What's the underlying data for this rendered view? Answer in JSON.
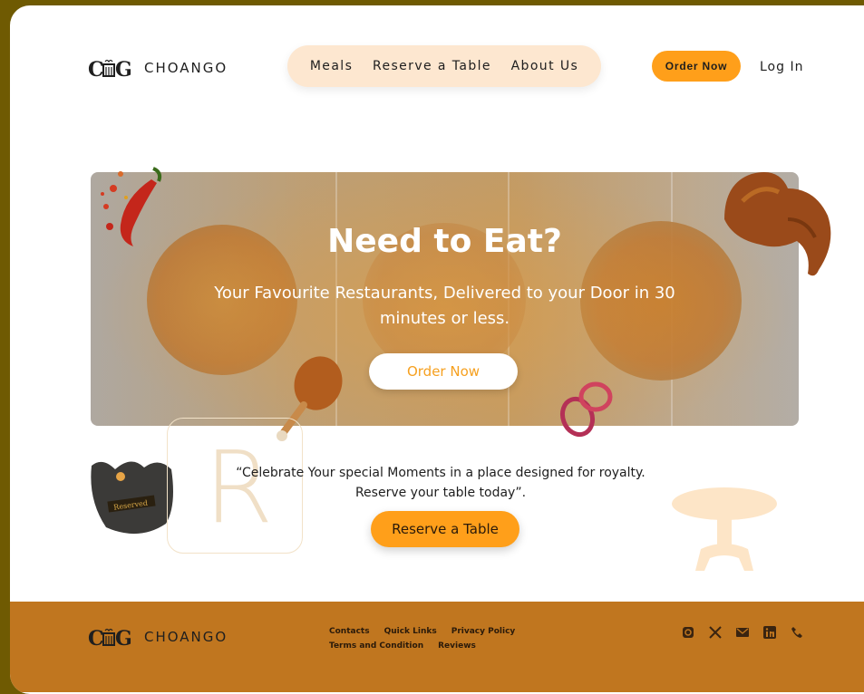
{
  "brand": {
    "name": "CHOANGO"
  },
  "header": {
    "nav": [
      {
        "label": "Meals"
      },
      {
        "label": "Reserve a Table"
      },
      {
        "label": "About Us"
      }
    ],
    "order_button": "Order Now",
    "login_link": "Log In"
  },
  "hero": {
    "title": "Need to Eat?",
    "subtitle": "Your Favourite Restaurants, Delivered to your Door in 30 minutes or less.",
    "cta": "Order Now"
  },
  "reserve": {
    "quote": "“Celebrate Your special Moments in a place designed for royalty. Reserve your  table today”.",
    "cta": "Reserve a Table",
    "badge_text": "Reserved",
    "outline_letter": "R"
  },
  "footer": {
    "links": [
      "Contacts",
      "Quick Links",
      "Privacy Policy",
      "Terms and Condition",
      "Reviews"
    ],
    "socials": [
      "instagram-icon",
      "x-icon",
      "mail-icon",
      "linkedin-icon",
      "phone-icon"
    ]
  },
  "colors": {
    "accent": "#ff9f1a",
    "footer": "#c0761f",
    "nav_pill": "#fde7d0",
    "outer_bg": "#6f5a02"
  }
}
